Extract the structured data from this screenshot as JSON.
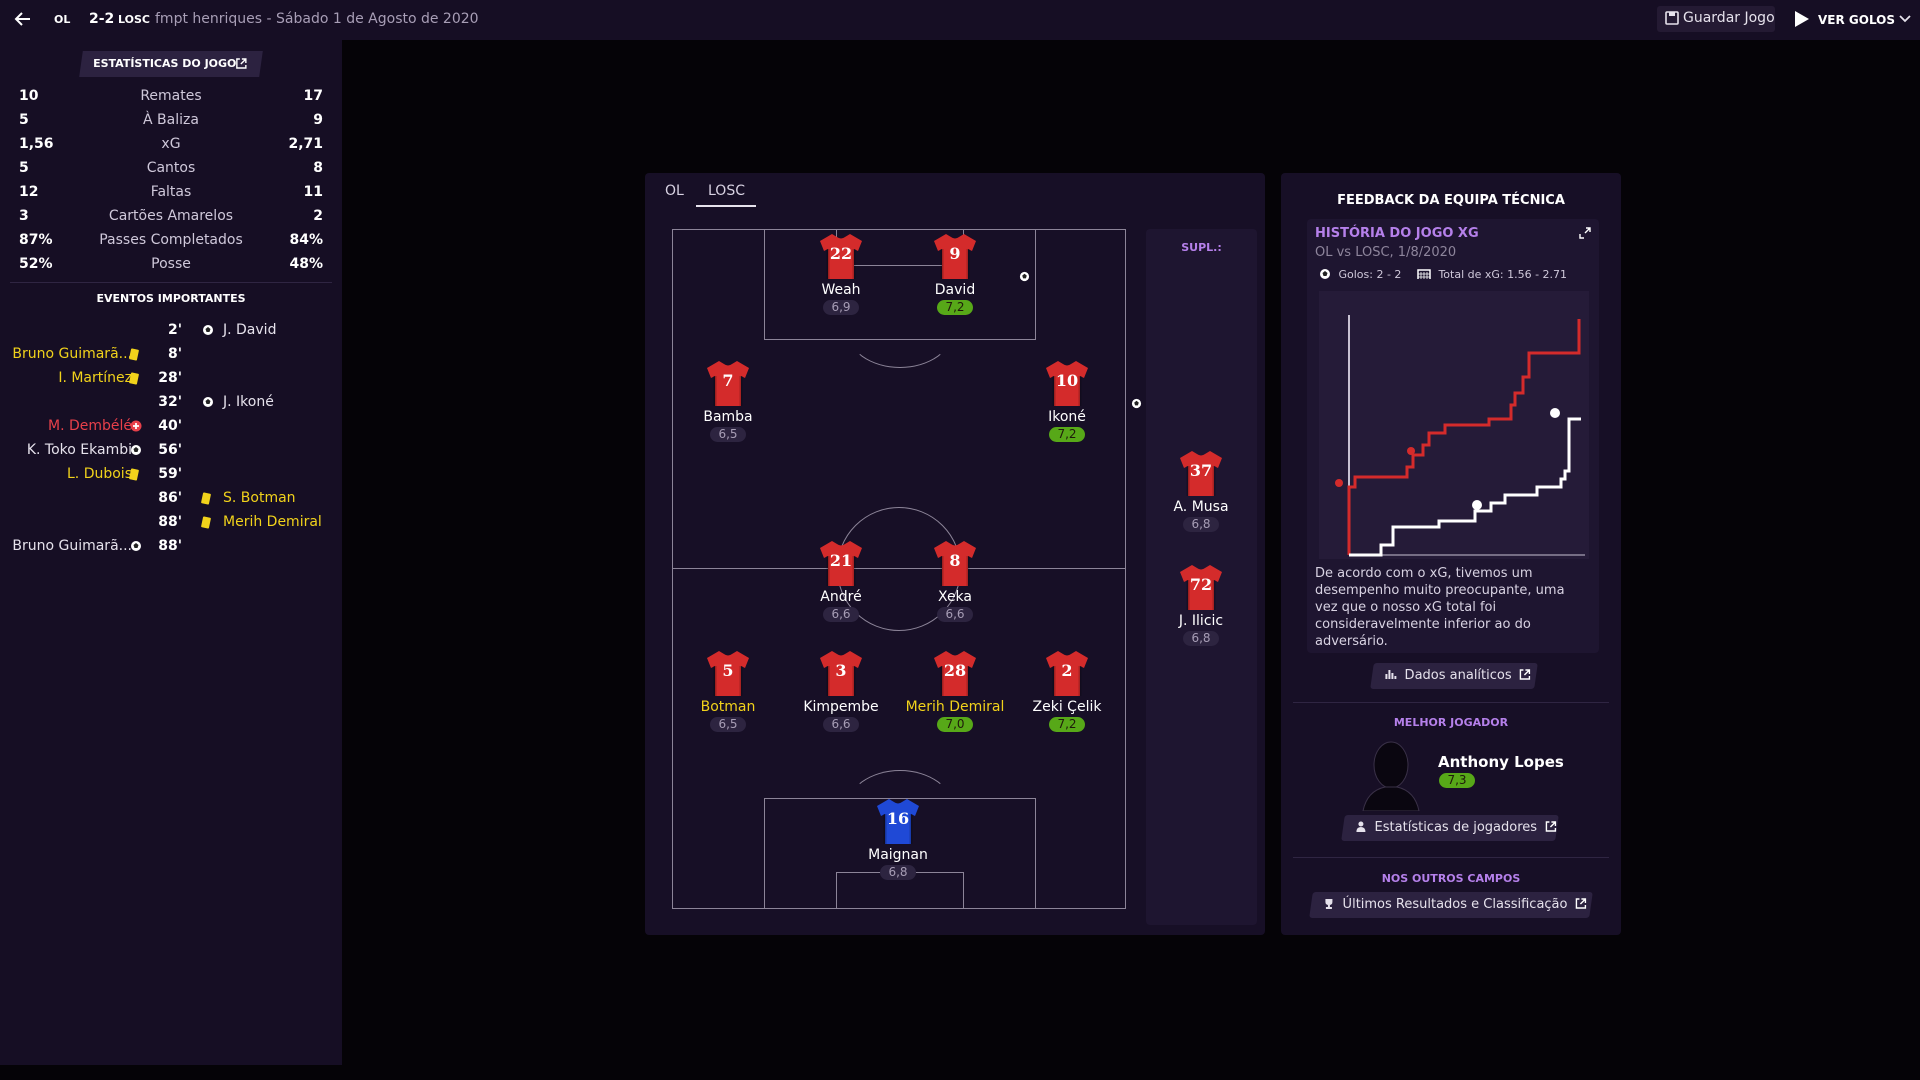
{
  "topbar": {
    "home_short": "OL",
    "score": "2-2",
    "away_short": "LOSC",
    "meta": "fmpt henriques - Sábado 1 de Agosto de 2020",
    "save_label": "Guardar Jogo",
    "goals_label": "VER GOLOS"
  },
  "stats": {
    "header": "ESTATÍSTICAS DO JOGO",
    "rows": [
      {
        "home": "10",
        "name": "Remates",
        "away": "17"
      },
      {
        "home": "5",
        "name": "À Baliza",
        "away": "9"
      },
      {
        "home": "1,56",
        "name": "xG",
        "away": "2,71"
      },
      {
        "home": "5",
        "name": "Cantos",
        "away": "8"
      },
      {
        "home": "12",
        "name": "Faltas",
        "away": "11"
      },
      {
        "home": "3",
        "name": "Cartões Amarelos",
        "away": "2"
      },
      {
        "home": "87%",
        "name": "Passes Completados",
        "away": "84%"
      },
      {
        "home": "52%",
        "name": "Posse",
        "away": "48%"
      }
    ]
  },
  "events": {
    "header": "EVENTOS IMPORTANTES",
    "items": [
      {
        "home": "",
        "home_icon": "",
        "minute": "2'",
        "away_icon": "goal",
        "away": "J. David",
        "color": "wht"
      },
      {
        "home": "Bruno Guimarã...",
        "home_icon": "yellow-card",
        "minute": "8'",
        "away_icon": "",
        "away": "",
        "color": "yel"
      },
      {
        "home": "I. Martínez",
        "home_icon": "yellow-card",
        "minute": "28'",
        "away_icon": "",
        "away": "",
        "color": "yel"
      },
      {
        "home": "",
        "home_icon": "",
        "minute": "32'",
        "away_icon": "goal",
        "away": "J. Ikoné",
        "color": "wht"
      },
      {
        "home": "M. Dembélé",
        "home_icon": "injury",
        "minute": "40'",
        "away_icon": "",
        "away": "",
        "color": "red"
      },
      {
        "home": "K. Toko Ekambi",
        "home_icon": "goal",
        "minute": "56'",
        "away_icon": "",
        "away": "",
        "color": "wht"
      },
      {
        "home": "L. Dubois",
        "home_icon": "yellow-card",
        "minute": "59'",
        "away_icon": "",
        "away": "",
        "color": "yel"
      },
      {
        "home": "",
        "home_icon": "",
        "minute": "86'",
        "away_icon": "yellow-card",
        "away": "S. Botman",
        "color": "yel"
      },
      {
        "home": "",
        "home_icon": "",
        "minute": "88'",
        "away_icon": "yellow-card",
        "away": "Merih Demiral",
        "color": "yel"
      },
      {
        "home": "Bruno Guimarã...",
        "home_icon": "goal",
        "minute": "88'",
        "away_icon": "",
        "away": "",
        "color": "wht"
      }
    ]
  },
  "lineup": {
    "tabs": [
      "OL",
      "LOSC"
    ],
    "active_tab": "LOSC",
    "subs_header": "SUPL.:",
    "players": [
      {
        "number": "22",
        "name": "Weah",
        "rating": "6,9",
        "good": false
      },
      {
        "number": "9",
        "name": "David",
        "rating": "7,2",
        "good": true
      },
      {
        "number": "7",
        "name": "Bamba",
        "rating": "6,5",
        "good": false
      },
      {
        "number": "10",
        "name": "Ikoné",
        "rating": "7,2",
        "good": true
      },
      {
        "number": "21",
        "name": "André",
        "rating": "6,6",
        "good": false
      },
      {
        "number": "8",
        "name": "Xeka",
        "rating": "6,6",
        "good": false
      },
      {
        "number": "5",
        "name": "Botman",
        "rating": "6,5",
        "good": false
      },
      {
        "number": "3",
        "name": "Kimpembe",
        "rating": "6,6",
        "good": false
      },
      {
        "number": "28",
        "name": "Merih Demiral",
        "rating": "7,0",
        "good": true
      },
      {
        "number": "2",
        "name": "Zeki Çelik",
        "rating": "7,2",
        "good": true
      },
      {
        "number": "16",
        "name": "Maignan",
        "rating": "6,8",
        "good": false
      }
    ],
    "subs": [
      {
        "number": "37",
        "name": "A. Musa",
        "rating": "6,8"
      },
      {
        "number": "72",
        "name": "J. Ilicic",
        "rating": "6,8"
      }
    ]
  },
  "feedback": {
    "title": "FEEDBACK DA EQUIPA TÉCNICA",
    "xg_title": "HISTÓRIA DO JOGO XG",
    "xg_subtitle": "OL vs LOSC, 1/8/2020",
    "goals_legend": "Golos: 2 - 2",
    "xg_total_legend": "Total de xG: 1.56 - 2.71",
    "text": "De acordo com o xG, tivemos um desempenho muito preocupante, uma vez que o nosso xG total foi consideravelmente inferior ao do adversário.",
    "analytics_btn": "Dados analíticos",
    "best_header": "MELHOR JOGADOR",
    "best_name": "Anthony Lopes",
    "best_rating": "7,3",
    "player_stats_btn": "Estatísticas de jogadores",
    "other_header": "NOS OUTROS CAMPOS",
    "results_btn": "Últimos Resultados e Classificação"
  },
  "colors": {
    "team_away": "#d42b2b",
    "team_home_xg": "#ffffff",
    "goalkeeper": "#1f49d6",
    "accent": "#b580ea",
    "good_rating": "#57a818"
  }
}
